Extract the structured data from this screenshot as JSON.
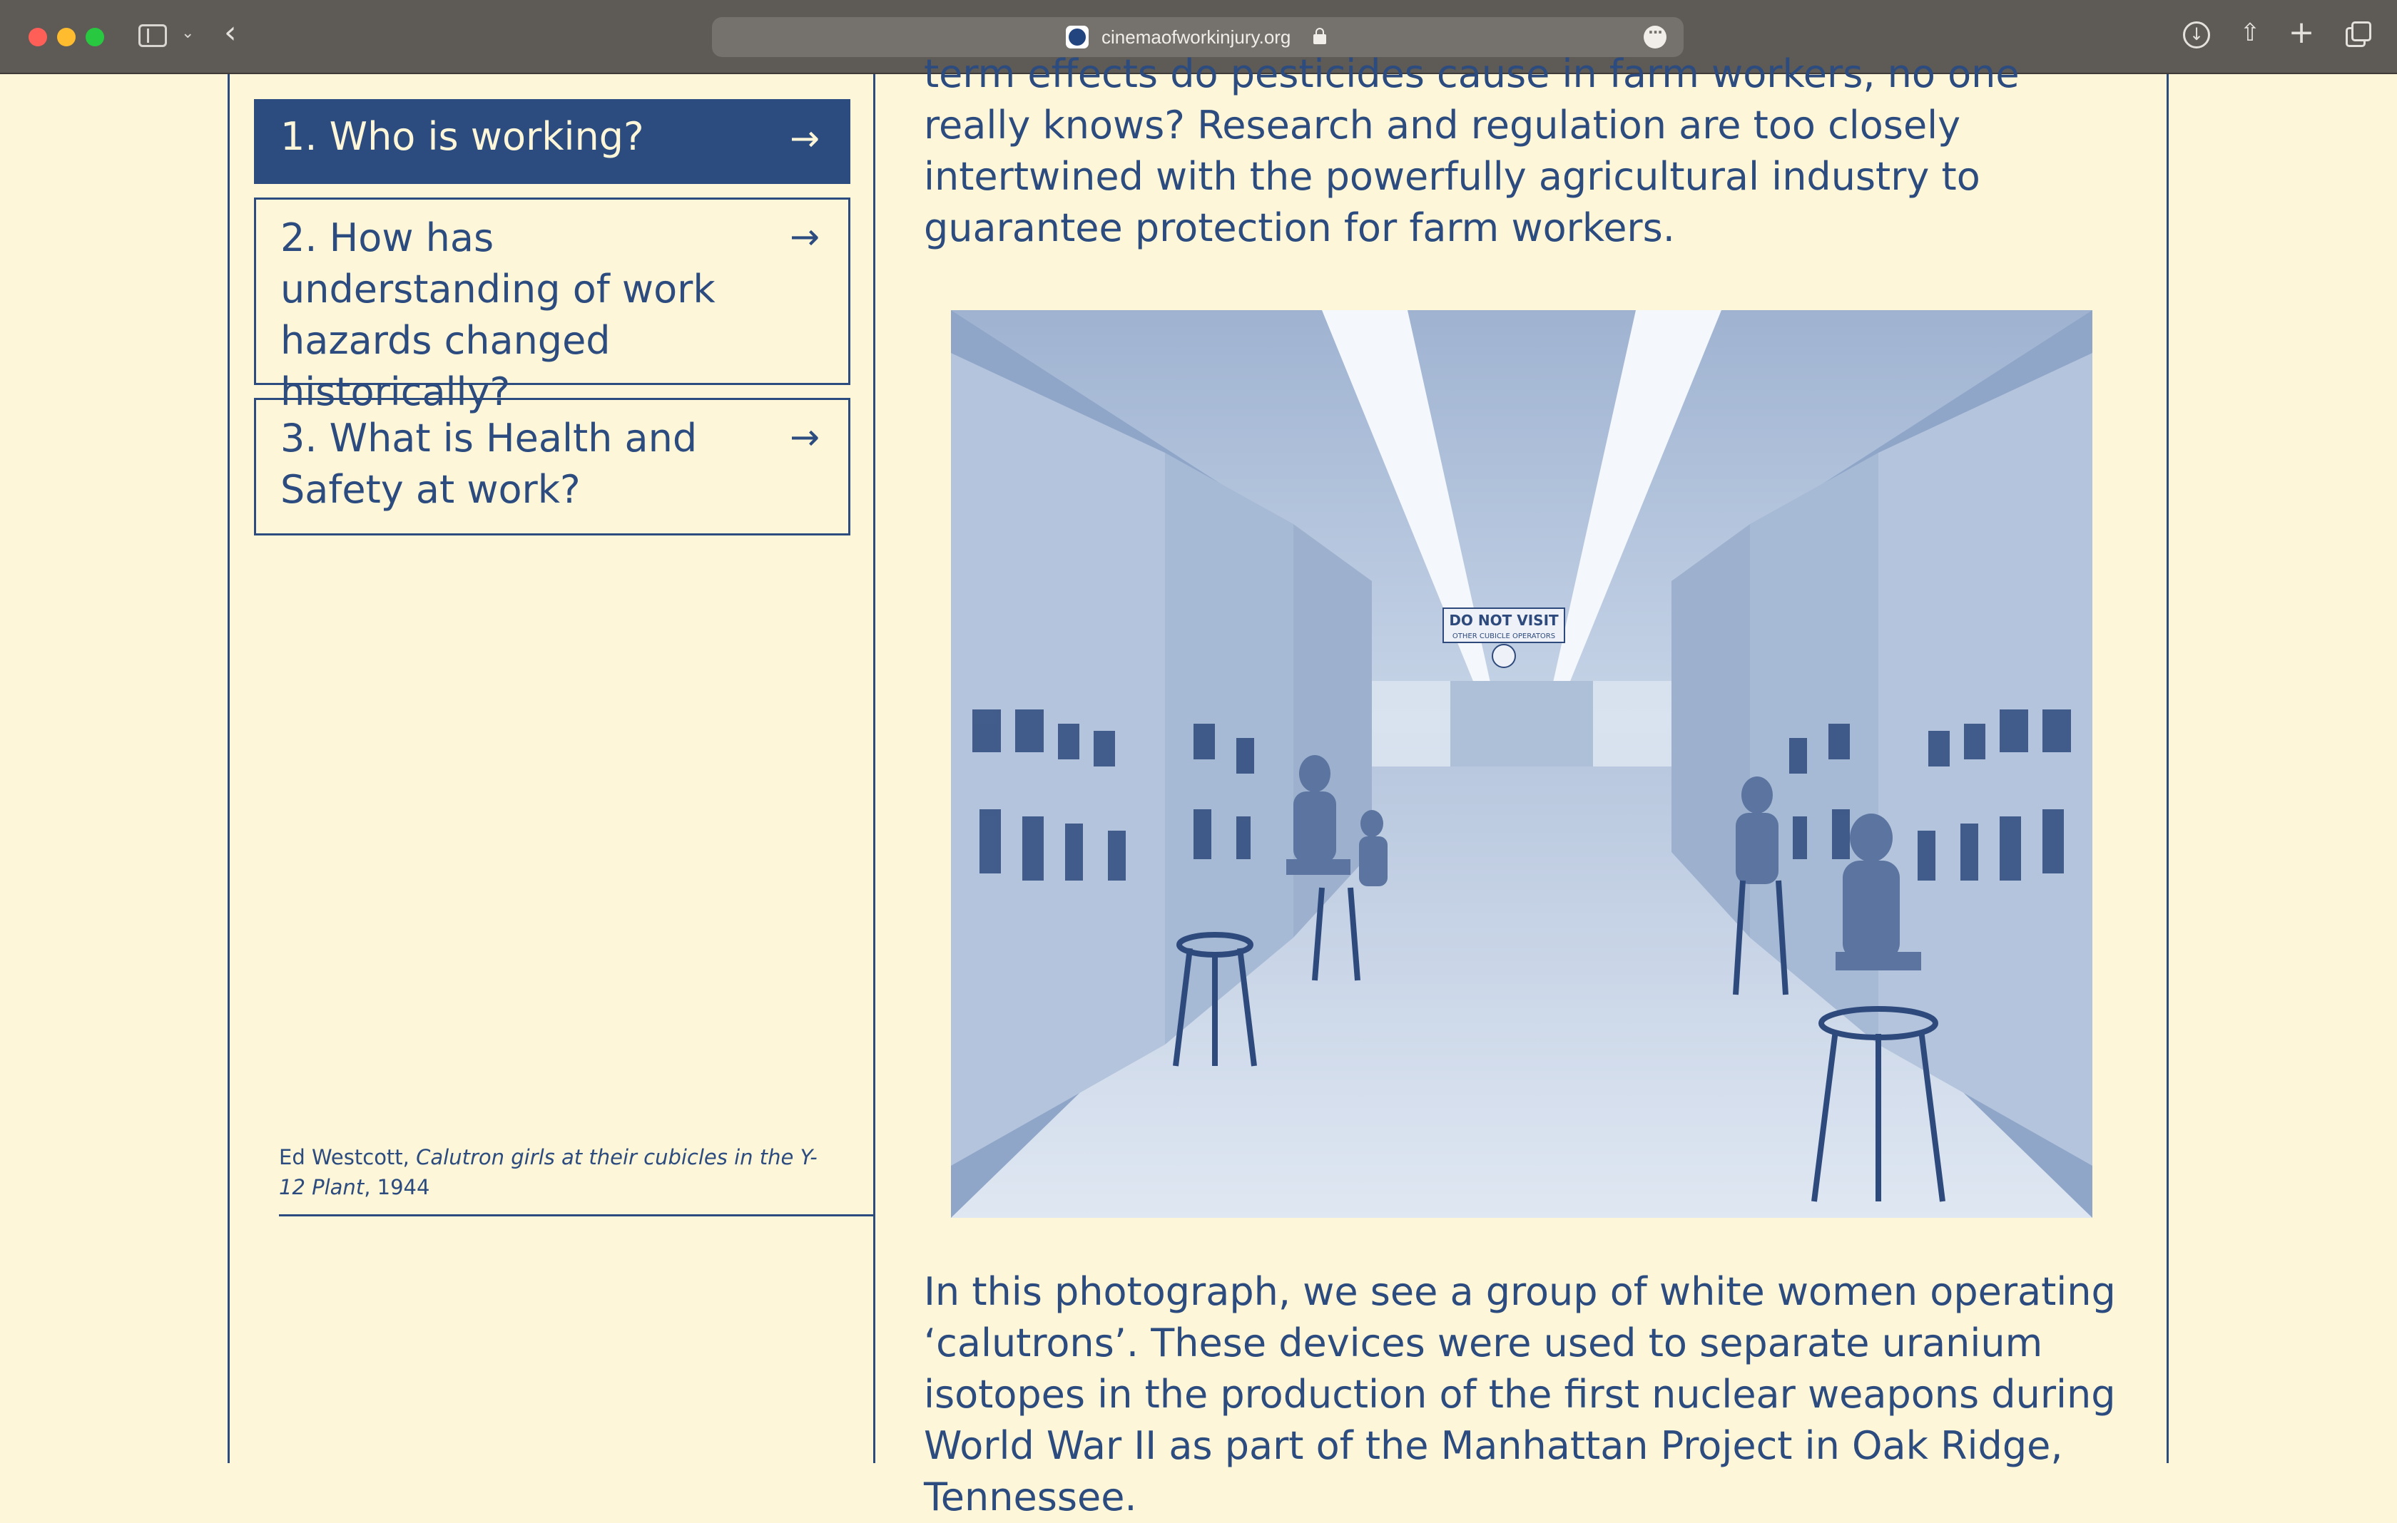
{
  "browser": {
    "url": "cinemaofworkinjury.org"
  },
  "nav": {
    "items": [
      {
        "label": "1. Who is working?",
        "arrow": "→"
      },
      {
        "label": "2. How has understanding of work hazards changed historically?",
        "arrow": "→"
      },
      {
        "label": "3. What is Health and Safety at work?",
        "arrow": "→"
      }
    ]
  },
  "caption": {
    "author": "Ed Westcott,",
    "title": "Calutron girls at their cubicles in the Y-12 Plant",
    "year": ", 1944"
  },
  "main": {
    "para_top": "term effects do pesticides cause in farm workers, no one really knows? Research and regulation are too closely intertwined with the powerfully agricultural industry to guarantee protection for farm workers.",
    "photo_sign": "DO NOT VISIT",
    "photo_sign_sub": "OTHER CUBICLE OPERATORS",
    "para_bottom": "In this photograph, we see a group of white women operating ‘calutrons’. These devices were used to separate uranium isotopes in the production of the first nuclear weapons during World War II as part of the Manhattan Project in Oak Ridge, Tennessee."
  },
  "colors": {
    "page_bg": "#fdf6d8",
    "ink": "#2c4b7f",
    "chrome": "#5e5a56"
  }
}
